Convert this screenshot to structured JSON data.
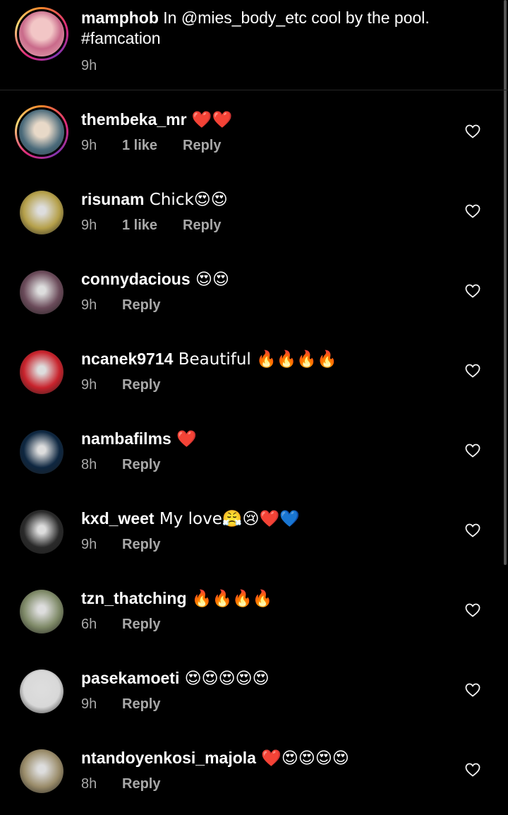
{
  "caption": {
    "username": "mamphob",
    "text": " In @mies_body_etc  cool by the pool.",
    "hashtag": "#famcation",
    "time": "9h"
  },
  "comments": [
    {
      "username": "thembeka_mr",
      "text": " ❤️❤️",
      "time": "9h",
      "likes": "1 like",
      "reply": "Reply",
      "avatar_color": "#4a6a7a",
      "ring": true
    },
    {
      "username": "risunam",
      "text": " Chick😍😍",
      "time": "9h",
      "likes": "1 like",
      "reply": "Reply",
      "avatar_color": "#b5a04a",
      "ring": false
    },
    {
      "username": "connydacious",
      "text": " 😍😍",
      "time": "9h",
      "likes": "",
      "reply": "Reply",
      "avatar_color": "#6b4b5a",
      "ring": false
    },
    {
      "username": "ncanek9714",
      "text": " Beautiful 🔥🔥🔥🔥",
      "time": "9h",
      "likes": "",
      "reply": "Reply",
      "avatar_color": "#c8232c",
      "ring": false
    },
    {
      "username": "nambafilms",
      "text": " ❤️",
      "time": "8h",
      "likes": "",
      "reply": "Reply",
      "avatar_color": "#0e2741",
      "ring": false
    },
    {
      "username": "kxd_weet",
      "text": " My love😤😢❤️💙",
      "time": "9h",
      "likes": "",
      "reply": "Reply",
      "avatar_color": "#2a2a2a",
      "ring": false
    },
    {
      "username": "tzn_thatching",
      "text": " 🔥🔥🔥🔥",
      "time": "6h",
      "likes": "",
      "reply": "Reply",
      "avatar_color": "#7f8a68",
      "ring": false
    },
    {
      "username": "pasekamoeti",
      "text": " 😍😍😍😍😍",
      "time": "9h",
      "likes": "",
      "reply": "Reply",
      "avatar_color": "#d8d8d8",
      "ring": false
    },
    {
      "username": "ntandoyenkosi_majola",
      "text": " ❤️😍😍😍😍",
      "time": "8h",
      "likes": "",
      "reply": "Reply",
      "avatar_color": "#9a8c6a",
      "ring": false
    }
  ]
}
